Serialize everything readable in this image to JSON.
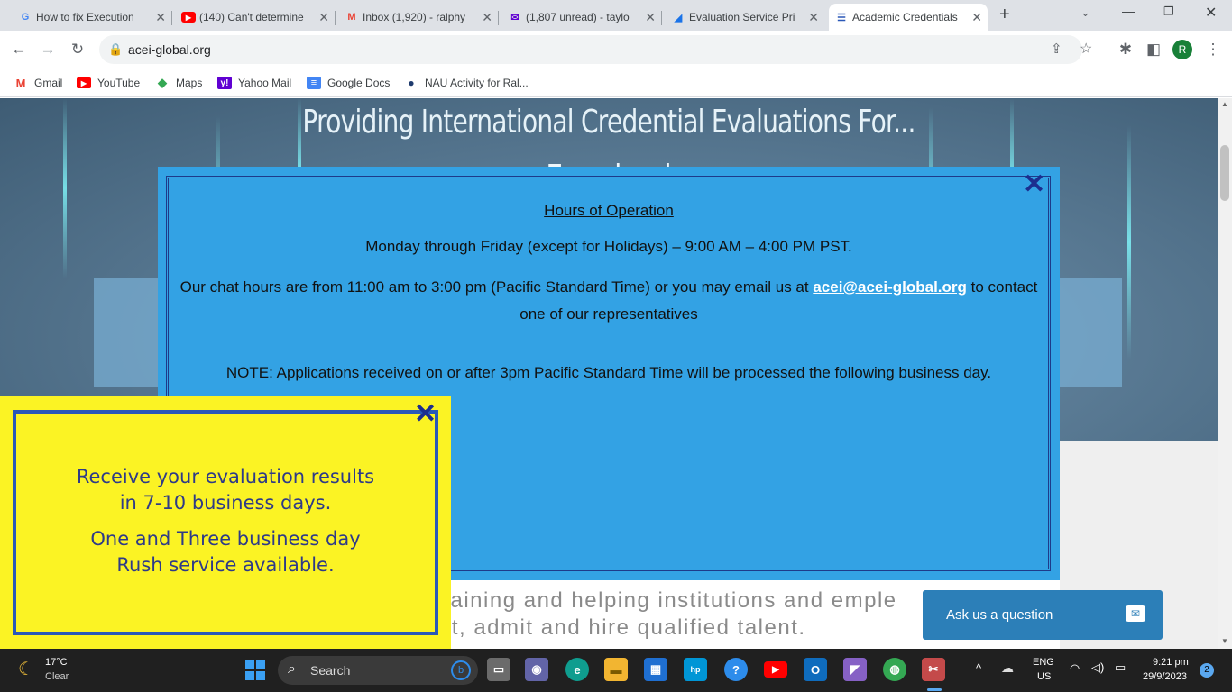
{
  "browser": {
    "tabs": [
      {
        "title": "How to fix Execution",
        "icon": "google-icon",
        "color": "#4285f4",
        "glyph": "G"
      },
      {
        "title": "(140) Can't determine",
        "icon": "youtube-icon",
        "color": "#ff0000",
        "glyph": "▶"
      },
      {
        "title": "Inbox (1,920) - ralphy",
        "icon": "gmail-icon",
        "color": "#ea4335",
        "glyph": "M"
      },
      {
        "title": "(1,807 unread) - taylo",
        "icon": "yahoo-mail-icon",
        "color": "#6001d2",
        "glyph": "✉"
      },
      {
        "title": "Evaluation Service Pri",
        "icon": "evaluation-site-icon",
        "color": "#1a73e8",
        "glyph": "◢"
      },
      {
        "title": "Academic Credentials",
        "icon": "acei-icon",
        "color": "#2a58b8",
        "glyph": "☰"
      }
    ],
    "new_tab": "+",
    "url": "acei-global.org",
    "profile_initial": "R",
    "bookmarks": [
      {
        "label": "Gmail",
        "icon": "gmail-icon",
        "color": "#ea4335",
        "glyph": "M"
      },
      {
        "label": "YouTube",
        "icon": "youtube-icon",
        "color": "#ff0000",
        "glyph": "▶"
      },
      {
        "label": "Maps",
        "icon": "maps-icon",
        "color": "#34a853",
        "glyph": "◆"
      },
      {
        "label": "Yahoo Mail",
        "icon": "yahoo-icon",
        "color": "#6001d2",
        "glyph": "y!"
      },
      {
        "label": "Google Docs",
        "icon": "docs-icon",
        "color": "#4285f4",
        "glyph": "≡"
      },
      {
        "label": "NAU Activity for Ral...",
        "icon": "person-icon",
        "color": "#1f3b6e",
        "glyph": "●"
      }
    ]
  },
  "page": {
    "hero_title": "Providing International Credential Evaluations For...",
    "hero_sub": "Emp                                                                                                    hool",
    "tagline_line1": "raining and helping institutions and emple",
    "tagline_line2": "it, admit and hire qualified talent."
  },
  "modal": {
    "heading": "Hours of Operation",
    "days": "Monday through Friday (except for Holidays) – 9:00 AM – 4:00 PM PST.",
    "chat_before": "Our chat hours are from 11:00 am to 3:00 pm (Pacific Standard Time) or you may email us at ",
    "chat_email": "acei@acei-global.org",
    "chat_after": " to contact one of our representatives",
    "note_label": "NOTE:",
    "note_text": " Applications received on or after 3pm Pacific Standard Time will be processed the following business day.",
    "close": "✕"
  },
  "promo": {
    "line1": "Receive your evaluation results",
    "line2": "in 7-10 business days.",
    "line3": "One and Three business day",
    "line4": "Rush service available.",
    "close": "✕"
  },
  "chat_widget": {
    "label": "Ask us a question"
  },
  "taskbar": {
    "weather_temp": "17°C",
    "weather_desc": "Clear",
    "search_placeholder": "Search",
    "lang_top": "ENG",
    "lang_bottom": "US",
    "time": "9:21 pm",
    "date": "29/9/2023",
    "notifications": "2",
    "apps": [
      {
        "name": "file-explorer-icon",
        "color": "#8a8a8a",
        "glyph": "▭"
      },
      {
        "name": "teams-icon",
        "color": "#6264a7",
        "glyph": "◉"
      },
      {
        "name": "edge-icon",
        "color": "#0f9d8f",
        "glyph": "e"
      },
      {
        "name": "folder-icon",
        "color": "#f2b531",
        "glyph": "▬"
      },
      {
        "name": "store-icon",
        "color": "#1f6fd1",
        "glyph": "▦"
      },
      {
        "name": "myhp-icon",
        "color": "#0096d6",
        "glyph": "hp"
      },
      {
        "name": "help-icon",
        "color": "#2d8ceb",
        "glyph": "?"
      },
      {
        "name": "youtube-icon",
        "color": "#ff0000",
        "glyph": "▶"
      },
      {
        "name": "outlook-icon",
        "color": "#0f6cbd",
        "glyph": "O"
      },
      {
        "name": "visual-studio-icon",
        "color": "#8661c5",
        "glyph": "◤"
      },
      {
        "name": "chrome-icon",
        "color": "#34a853",
        "glyph": "◍"
      },
      {
        "name": "snipping-tool-icon",
        "color": "#c44a4a",
        "glyph": "✂"
      }
    ]
  }
}
